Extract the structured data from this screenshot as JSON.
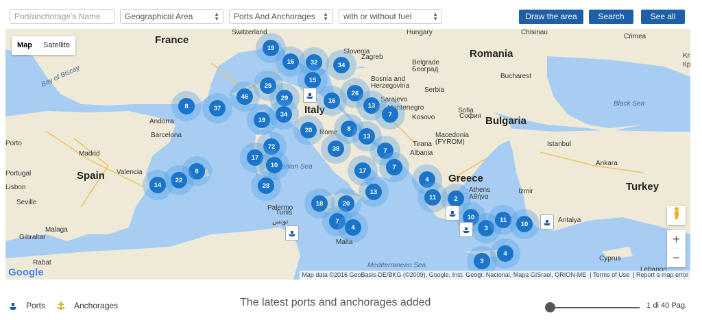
{
  "filters": {
    "name_placeholder": "Port/anchorage's Name",
    "geo_area": "Geographical Area",
    "type": "Ports And Anchorages",
    "fuel": "with or without fuel"
  },
  "buttons": {
    "draw_area": "Draw the area",
    "search": "Search",
    "see_all": "See all"
  },
  "map": {
    "maptype": {
      "map": "Map",
      "satellite": "Satellite"
    },
    "attribution": "Map data ©2016 GeoBasis-DE/BKG (©2009), Google, Inst. Geogr. Nacional, Mapa GISrael, ORION-ME",
    "terms": "Terms of Use",
    "report": "Report a map error",
    "zoom_in": "+",
    "zoom_out": "−",
    "google_logo": "Google",
    "countries": [
      "France",
      "Romania",
      "Italy",
      "Bulgaria",
      "Spain",
      "Turkey",
      "Greece"
    ],
    "places": [
      "Switzerland",
      "Hungary",
      "Chisinau",
      "Slovenia",
      "Zagreb",
      "Belgrade",
      "Београд",
      "Bosnia and",
      "Herzegovina",
      "Serbia",
      "Sarajevo",
      "Montenegro",
      "Kosovo",
      "Sofia",
      "София",
      "Bucharest",
      "Andorra",
      "Barcelona",
      "Rome",
      "Tirana",
      "Macedonia",
      "(FYROM)",
      "Albania",
      "Istanbul",
      "Ankara",
      "Madrid",
      "Valencia",
      "Portugal",
      "Tunis",
      "تونس",
      "Athens",
      "Αθήνα",
      "Izmir",
      "Antalya",
      "Malta",
      "Palermo",
      "Cyprus",
      "Rabat",
      "Gibraltar",
      "Malaga",
      "Seville",
      "Lebanon",
      "Porto",
      "Lisbon",
      "Crimea",
      "Kri",
      "Кра"
    ],
    "seas": [
      "Bay of Biscay",
      "Black Sea",
      "Tyrrhenian Sea",
      "Mediterranean Sea"
    ],
    "clusters": [
      "19",
      "16",
      "32",
      "34",
      "15",
      "25",
      "46",
      "29",
      "26",
      "8",
      "37",
      "16",
      "13",
      "7",
      "34",
      "19",
      "20",
      "8",
      "13",
      "72",
      "38",
      "7",
      "17",
      "10",
      "7",
      "17",
      "28",
      "13",
      "8",
      "22",
      "14",
      "4",
      "18",
      "20",
      "2",
      "11",
      "10",
      "7",
      "4",
      "3",
      "11",
      "10",
      "3",
      "4"
    ]
  },
  "footer": {
    "legend_ports": "Ports",
    "legend_anchorages": "Anchorages",
    "title": "The latest ports and anchorages added",
    "pager": "1 di 40",
    "pager_suffix": "Pag."
  },
  "colors": {
    "accent": "#1f5fa8",
    "cluster": "#1a74c9",
    "water": "#a7cdf2",
    "land": "#efe9d7"
  }
}
